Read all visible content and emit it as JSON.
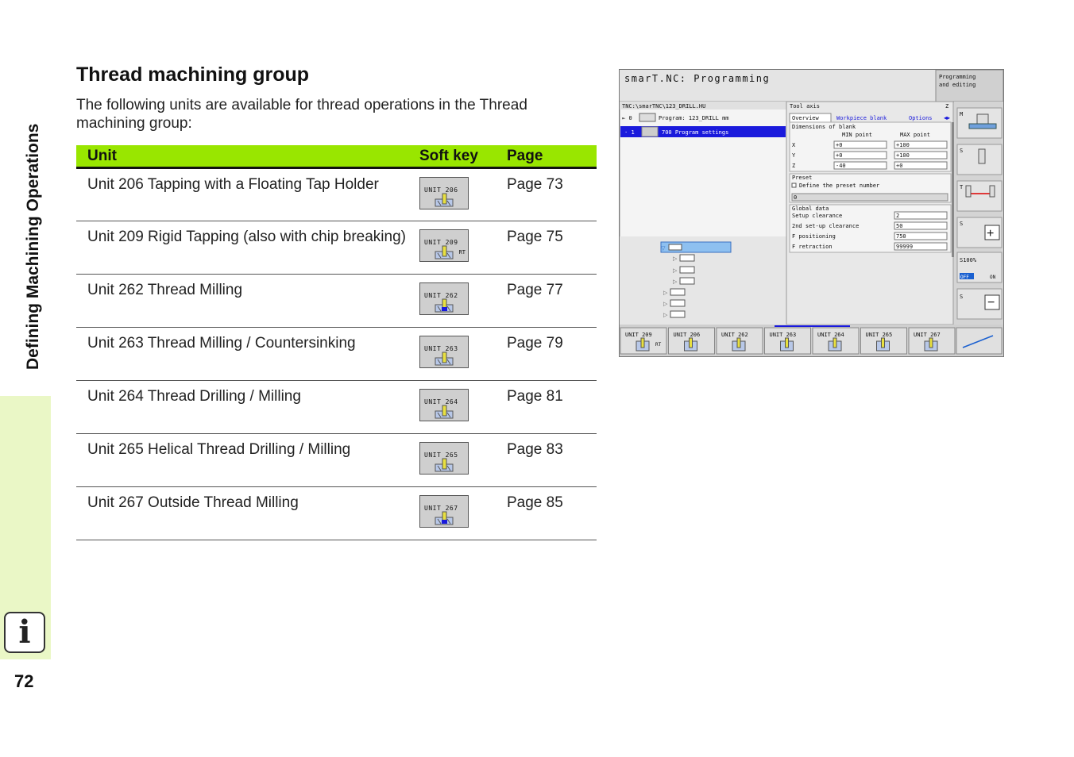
{
  "sidebar": {
    "title": "Defining Machining Operations",
    "info_icon": "info-icon",
    "accent_color": "#eaf7c6"
  },
  "page_number": "72",
  "heading": "Thread machining group",
  "intro": "The following units are available for thread operations in the Thread machining group:",
  "table": {
    "headers": {
      "unit": "Unit",
      "softkey": "Soft key",
      "page": "Page"
    },
    "header_color": "#99e600",
    "rows": [
      {
        "unit": "Unit 206 Tapping with a Floating Tap Holder",
        "softkey": "UNIT 206",
        "softkey_sub": "",
        "page": "Page 73"
      },
      {
        "unit": "Unit 209 Rigid Tapping (also with chip breaking)",
        "softkey": "UNIT 209",
        "softkey_sub": "RT",
        "page": "Page 75"
      },
      {
        "unit": "Unit 262 Thread Milling",
        "softkey": "UNIT 262",
        "softkey_sub": "",
        "page": "Page 77"
      },
      {
        "unit": "Unit 263 Thread Milling / Countersinking",
        "softkey": "UNIT 263",
        "softkey_sub": "",
        "page": "Page 79"
      },
      {
        "unit": "Unit 264 Thread Drilling / Milling",
        "softkey": "UNIT 264",
        "softkey_sub": "",
        "page": "Page 81"
      },
      {
        "unit": "Unit 265 Helical Thread Drilling / Milling",
        "softkey": "UNIT 265",
        "softkey_sub": "",
        "page": "Page 83"
      },
      {
        "unit": "Unit 267 Outside Thread Milling",
        "softkey": "UNIT 267",
        "softkey_sub": "",
        "page": "Page 85"
      }
    ]
  },
  "screenshot": {
    "title": "smarT.NC: Programming",
    "mode": "Programming and editing",
    "path": "TNC:\\smarTNC\\123_DRILL.HU",
    "tree": [
      {
        "num": "0",
        "text": "Program: 123_DRILL mm"
      },
      {
        "num": "1",
        "text": "700 Program settings"
      }
    ],
    "tool_axis_label": "Tool axis",
    "tool_axis_value": "Z",
    "tabs": [
      "Overview",
      "Workpiece blank",
      "Options"
    ],
    "blank": {
      "title": "Dimensions of blank",
      "min_label": "MIN point",
      "max_label": "MAX point",
      "rows": [
        {
          "axis": "X",
          "min": "+0",
          "max": "+100"
        },
        {
          "axis": "Y",
          "min": "+0",
          "max": "+100"
        },
        {
          "axis": "Z",
          "min": "-40",
          "max": "+0"
        }
      ]
    },
    "preset": {
      "title": "Preset",
      "checkbox": "Define the preset number",
      "value": "0"
    },
    "global": {
      "title": "Global data",
      "rows": [
        {
          "label": "Setup clearance",
          "value": "2"
        },
        {
          "label": "2nd set-up clearance",
          "value": "50"
        },
        {
          "label": "F positioning",
          "value": "750"
        },
        {
          "label": "F retraction",
          "value": "99999"
        }
      ]
    },
    "side_keys": [
      "M",
      "S",
      "T",
      "S",
      "S100%",
      "S"
    ],
    "side_off": "OFF",
    "side_on": "ON",
    "softkeys": [
      {
        "label": "UNIT 209",
        "sub": "RT"
      },
      {
        "label": "UNIT 206",
        "sub": ""
      },
      {
        "label": "UNIT 262",
        "sub": ""
      },
      {
        "label": "UNIT 263",
        "sub": ""
      },
      {
        "label": "UNIT 264",
        "sub": ""
      },
      {
        "label": "UNIT 265",
        "sub": ""
      },
      {
        "label": "UNIT 267",
        "sub": ""
      }
    ]
  }
}
